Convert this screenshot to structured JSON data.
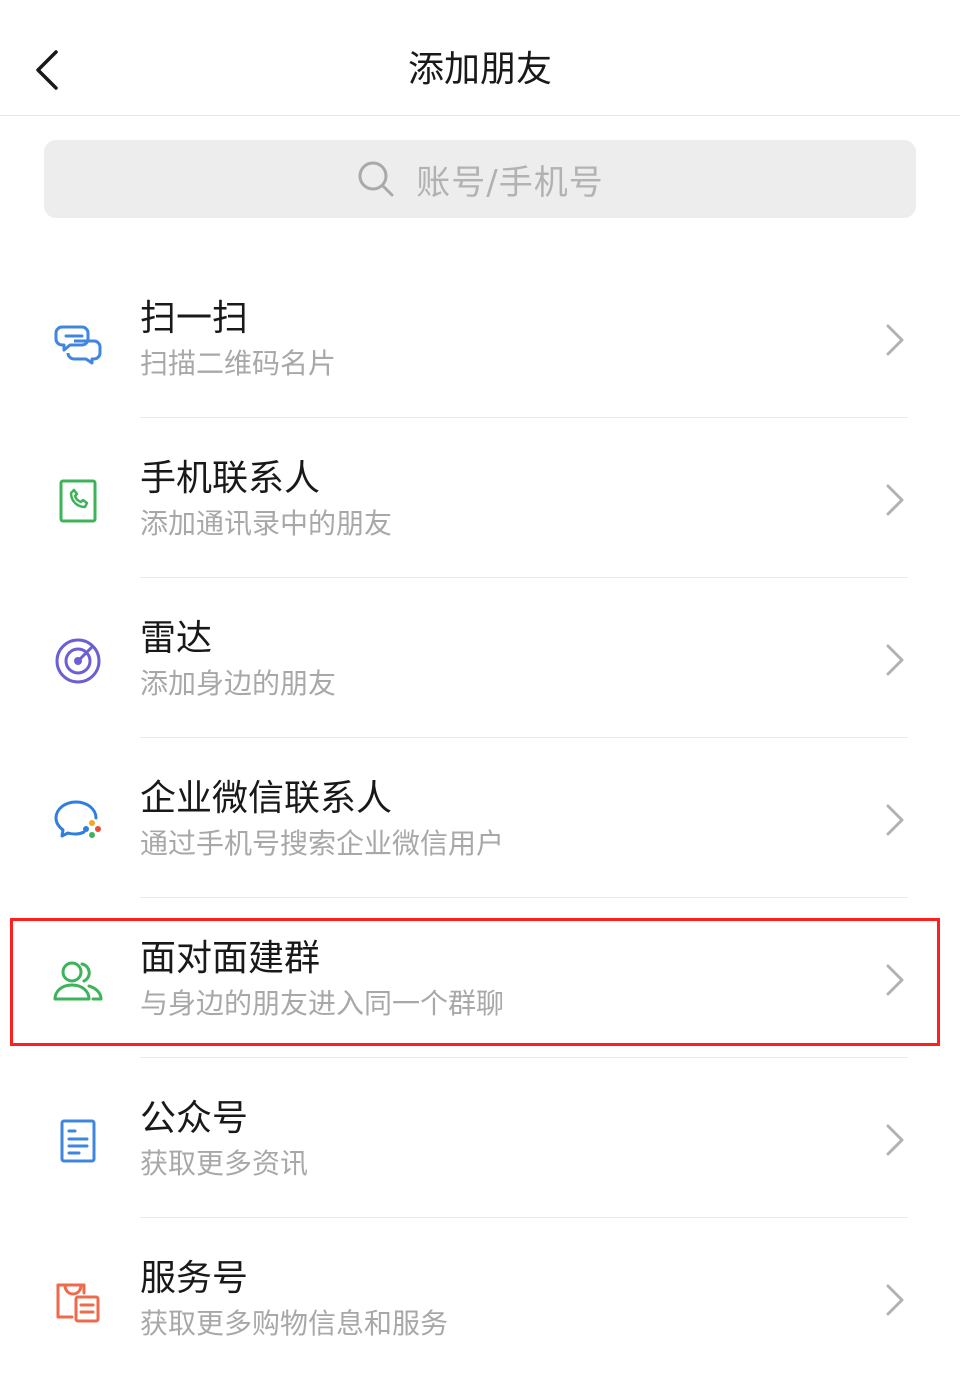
{
  "header": {
    "title": "添加朋友",
    "back_icon": "chevron-left-icon"
  },
  "search": {
    "placeholder": "账号/手机号",
    "icon": "search-icon"
  },
  "items": [
    {
      "title": "扫一扫",
      "subtitle": "扫描二维码名片",
      "icon": "scan-icon",
      "color": "#3f86e0"
    },
    {
      "title": "手机联系人",
      "subtitle": "添加通讯录中的朋友",
      "icon": "phone-contact-icon",
      "color": "#3db35a"
    },
    {
      "title": "雷达",
      "subtitle": "添加身边的朋友",
      "icon": "radar-icon",
      "color": "#6b5fd6"
    },
    {
      "title": "企业微信联系人",
      "subtitle": "通过手机号搜索企业微信用户",
      "icon": "wecom-icon",
      "color": "#2f7ee0"
    },
    {
      "title": "面对面建群",
      "subtitle": "与身边的朋友进入同一个群聊",
      "icon": "group-icon",
      "color": "#3db35a"
    },
    {
      "title": "公众号",
      "subtitle": "获取更多资讯",
      "icon": "official-account-icon",
      "color": "#3f86e0"
    },
    {
      "title": "服务号",
      "subtitle": "获取更多购物信息和服务",
      "icon": "service-account-icon",
      "color": "#ef6a4a"
    }
  ],
  "highlight_color": "#ff1f1f"
}
